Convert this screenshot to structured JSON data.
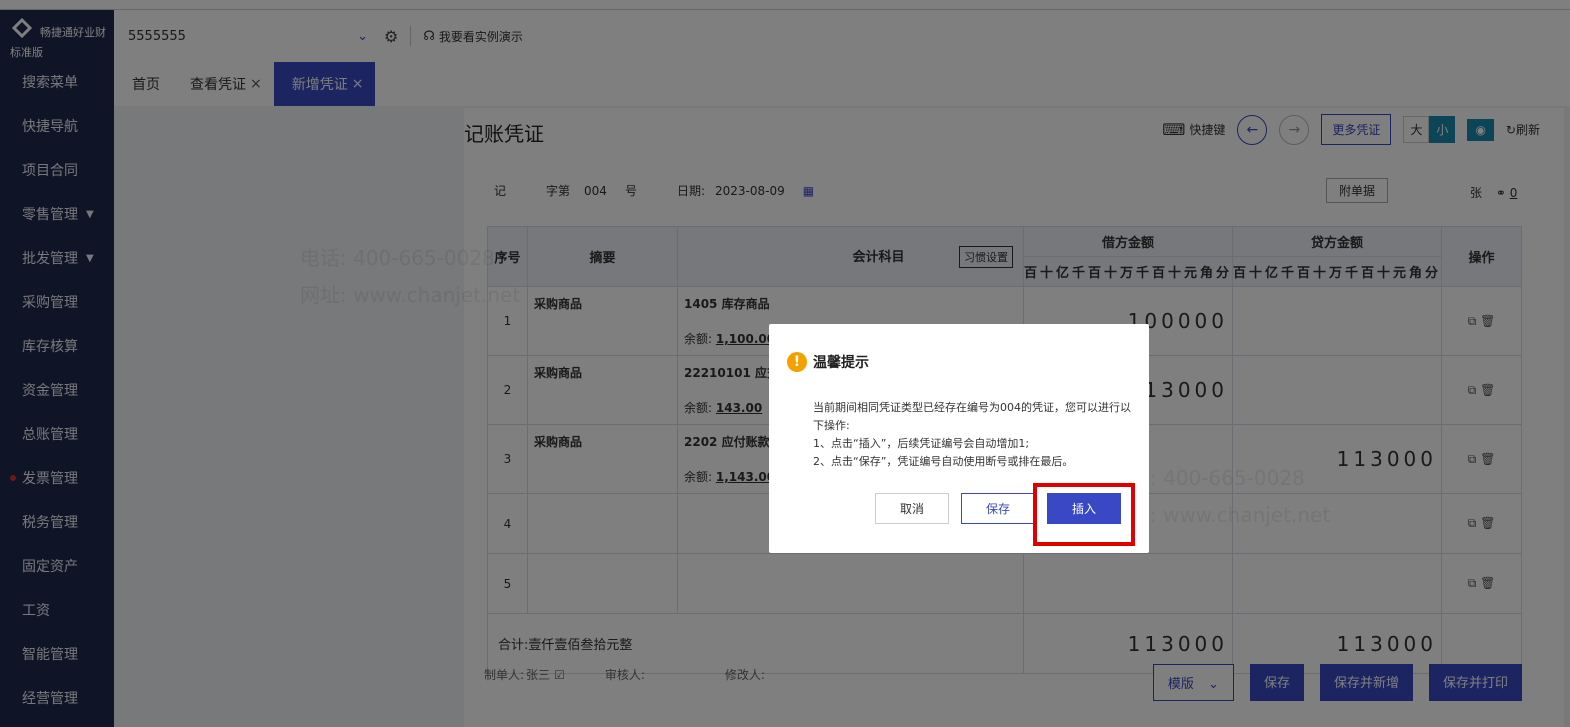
{
  "brand": {
    "name": "畅捷通好业财",
    "edition": "标准版"
  },
  "sidebar": {
    "items": [
      {
        "label": "搜索菜单"
      },
      {
        "label": "快捷导航"
      },
      {
        "label": "项目合同"
      },
      {
        "label": "零售管理",
        "caret": "▼"
      },
      {
        "label": "批发管理",
        "caret": "▼"
      },
      {
        "label": "采购管理"
      },
      {
        "label": "库存核算"
      },
      {
        "label": "资金管理"
      },
      {
        "label": "总账管理"
      },
      {
        "label": "发票管理"
      },
      {
        "label": "税务管理"
      },
      {
        "label": "固定资产"
      },
      {
        "label": "工资"
      },
      {
        "label": "智能管理"
      },
      {
        "label": "经营管理"
      }
    ]
  },
  "topbar": {
    "account": "5555555",
    "chevron": "⌄",
    "settings_icon": "⚙",
    "demo_icon": "☊",
    "demo": "我要看实例演示"
  },
  "tabs": [
    {
      "label": "首页"
    },
    {
      "label": "查看凭证",
      "close": "×"
    },
    {
      "label": "新增凭证",
      "close": "×"
    }
  ],
  "voucher": {
    "title": "记账凭证",
    "toolbar": {
      "shortcut_icon": "⌨",
      "shortcut": "快捷键",
      "prev": "←",
      "next": "→",
      "more": "更多凭证",
      "big": "大",
      "small": "小",
      "eye": "◉",
      "refresh_icon": "↻",
      "refresh": "刷新"
    },
    "type": "记",
    "word_label": "字第",
    "number": "004",
    "number_suffix": "号",
    "date_label": "日期:",
    "date": "2023-08-09",
    "calendar_icon": "▦",
    "attach": "附单据",
    "attach_unit": "张",
    "link_icon": "⚭",
    "attach_count": "0",
    "headers": {
      "seq": "序号",
      "summary": "摘要",
      "account": "会计科目",
      "habit": "习惯设置",
      "debit": "借方金额",
      "credit": "贷方金额",
      "ops": "操作"
    },
    "digit_units": "百十亿千百十万千百十元角分",
    "rows": [
      {
        "seq": "1",
        "summary": "采购商品",
        "account": "1405 库存商品",
        "balance_label": "余额:",
        "balance": "1,100.00",
        "debit": "100000",
        "credit": ""
      },
      {
        "seq": "2",
        "summary": "采购商品",
        "account": "22210101 应交",
        "balance_label": "余额:",
        "balance": "143.00",
        "debit": "13000",
        "credit": ""
      },
      {
        "seq": "3",
        "summary": "采购商品",
        "account": "2202 应付账款",
        "balance_label": "余额:",
        "balance": "1,143.00",
        "debit": "",
        "credit": "113000"
      },
      {
        "seq": "4",
        "summary": "",
        "account": "",
        "balance_label": "",
        "balance": "",
        "debit": "",
        "credit": ""
      },
      {
        "seq": "5",
        "summary": "",
        "account": "",
        "balance_label": "",
        "balance": "",
        "debit": "",
        "credit": ""
      }
    ],
    "ops_icons": "⧉ 🗑",
    "total_label": "合计:",
    "total_text": "壹仟壹佰叁拾元整",
    "total_debit": "113000",
    "total_credit": "113000",
    "maker_label": "制单人:",
    "maker": "张三",
    "edit_icon": "☑",
    "auditor_label": "审核人:",
    "modifier_label": "修改人:",
    "buttons": {
      "template": "模版",
      "template_caret": "⌄",
      "save": "保存",
      "save_new": "保存并新增",
      "save_print": "保存并打印"
    }
  },
  "watermark": {
    "phone": "电话: 400-665-0028",
    "site": "网址: www.chanjet.net"
  },
  "dialog": {
    "icon": "!",
    "title": "温馨提示",
    "line1": "当前期间相同凭证类型已经存在编号为004的凭证，您可以进行以下操作:",
    "line2": "1、点击“插入”，后续凭证编号会自动增加1;",
    "line3": "2、点击“保存”，凭证编号自动使用断号或排在最后。",
    "cancel": "取消",
    "save": "保存",
    "insert": "插入"
  }
}
